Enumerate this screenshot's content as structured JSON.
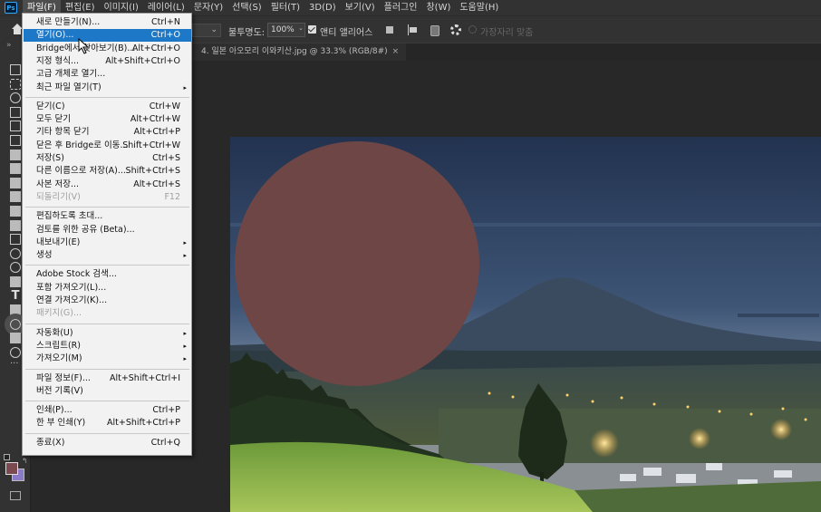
{
  "app": {
    "logo_text": "Ps"
  },
  "menubar": {
    "items": [
      "파일(F)",
      "편집(E)",
      "이미지(I)",
      "레이어(L)",
      "문자(Y)",
      "선택(S)",
      "필터(T)",
      "3D(D)",
      "보기(V)",
      "플러그인",
      "창(W)",
      "도움말(H)"
    ],
    "active_index": 0
  },
  "options_bar": {
    "opacity_label": "불투명도:",
    "opacity_value": "100%",
    "antialias_checked": true,
    "antialias_label": "앤티 앨리어스",
    "align_edges_label": "가장자리 맞춤",
    "align_edges_checked": false
  },
  "document_tab": {
    "title": "4. 일본 아오모리 이와키산.jpg @ 33.3% (RGB/8#)",
    "close": "×"
  },
  "file_menu": {
    "groups": [
      [
        {
          "label": "새로 만들기(N)...",
          "shortcut": "Ctrl+N"
        },
        {
          "label": "열기(O)...",
          "shortcut": "Ctrl+O",
          "highlighted": true
        },
        {
          "label": "Bridge에서 찾아보기(B)...",
          "shortcut": "Alt+Ctrl+O"
        },
        {
          "label": "지정 형식...",
          "shortcut": "Alt+Shift+Ctrl+O"
        },
        {
          "label": "고급 개체로 열기...",
          "shortcut": ""
        },
        {
          "label": "최근 파일 열기(T)",
          "shortcut": "",
          "submenu": true
        }
      ],
      [
        {
          "label": "닫기(C)",
          "shortcut": "Ctrl+W"
        },
        {
          "label": "모두 닫기",
          "shortcut": "Alt+Ctrl+W"
        },
        {
          "label": "기타 항목 닫기",
          "shortcut": "Alt+Ctrl+P"
        },
        {
          "label": "닫은 후 Bridge로 이동...",
          "shortcut": "Shift+Ctrl+W"
        },
        {
          "label": "저장(S)",
          "shortcut": "Ctrl+S"
        },
        {
          "label": "다른 이름으로 저장(A)...",
          "shortcut": "Shift+Ctrl+S"
        },
        {
          "label": "사본 저장...",
          "shortcut": "Alt+Ctrl+S"
        },
        {
          "label": "되돌리기(V)",
          "shortcut": "F12",
          "disabled": true
        }
      ],
      [
        {
          "label": "편집하도록 초대...",
          "shortcut": ""
        },
        {
          "label": "검토를 위한 공유 (Beta)...",
          "shortcut": ""
        },
        {
          "label": "내보내기(E)",
          "shortcut": "",
          "submenu": true
        },
        {
          "label": "생성",
          "shortcut": "",
          "submenu": true
        }
      ],
      [
        {
          "label": "Adobe Stock 검색...",
          "shortcut": ""
        },
        {
          "label": "포함 가져오기(L)...",
          "shortcut": ""
        },
        {
          "label": "연결 가져오기(K)...",
          "shortcut": ""
        },
        {
          "label": "패키지(G)...",
          "shortcut": "",
          "disabled": true
        }
      ],
      [
        {
          "label": "자동화(U)",
          "shortcut": "",
          "submenu": true
        },
        {
          "label": "스크립트(R)",
          "shortcut": "",
          "submenu": true
        },
        {
          "label": "가져오기(M)",
          "shortcut": "",
          "submenu": true
        }
      ],
      [
        {
          "label": "파일 정보(F)...",
          "shortcut": "Alt+Shift+Ctrl+I"
        },
        {
          "label": "버전 기록(V)",
          "shortcut": ""
        }
      ],
      [
        {
          "label": "인쇄(P)...",
          "shortcut": "Ctrl+P"
        },
        {
          "label": "한 부 인쇄(Y)",
          "shortcut": "Alt+Shift+Ctrl+P"
        }
      ],
      [
        {
          "label": "종료(X)",
          "shortcut": "Ctrl+Q"
        }
      ]
    ],
    "submenu_arrow": "▸"
  },
  "toolbar": {
    "tools": [
      "move-tool",
      "marquee-tool",
      "lasso-tool",
      "object-selection-tool",
      "crop-tool",
      "frame-tool",
      "eyedropper-tool",
      "healing-brush-tool",
      "brush-tool",
      "clone-stamp-tool",
      "history-brush-tool",
      "eraser-tool",
      "gradient-tool",
      "blur-tool",
      "dodge-tool",
      "pen-tool",
      "type-tool",
      "path-selection-tool",
      "ellipse-tool",
      "hand-tool",
      "zoom-tool",
      "more-tools"
    ],
    "type_tool_glyph": "T",
    "active_tool": "ellipse-tool",
    "foreground_color": "#7a4a50",
    "background_color": "#8a7ac8"
  },
  "canvas": {
    "ellipse_fill": "#6e4646",
    "description_colors": {
      "sky_top": "#2b3d5c",
      "sky_bottom": "#5d7594",
      "mountain": "#3b4c60",
      "forest": "#1e2a1c",
      "grass": "#7da24a"
    }
  }
}
